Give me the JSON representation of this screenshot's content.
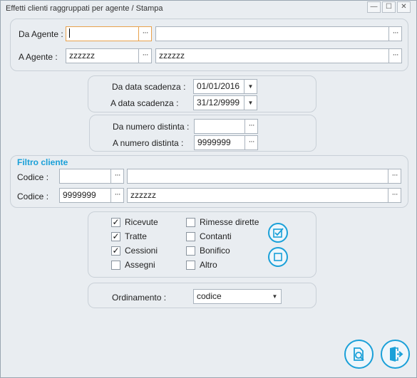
{
  "window": {
    "title": "Effetti clienti raggruppati per agente / Stampa"
  },
  "agent": {
    "from_label": "Da Agente :",
    "from_code": "",
    "from_desc": "",
    "to_label": "A Agente :",
    "to_code": "zzzzzz",
    "to_desc": "zzzzzz"
  },
  "dates": {
    "from_label": "Da data scadenza :",
    "from_value": "01/01/2016",
    "to_label": "A data scadenza :",
    "to_value": "31/12/9999"
  },
  "distinta": {
    "from_label": "Da numero distinta :",
    "from_value": "",
    "to_label": "A numero distinta :",
    "to_value": "9999999"
  },
  "client_filter": {
    "title": "Filtro cliente",
    "from_label": "Codice :",
    "from_code": "",
    "from_desc": "",
    "to_label": "Codice :",
    "to_code": "9999999",
    "to_desc": "zzzzzz"
  },
  "types": {
    "left": [
      {
        "label": "Ricevute",
        "checked": true
      },
      {
        "label": "Tratte",
        "checked": true
      },
      {
        "label": "Cessioni",
        "checked": true
      },
      {
        "label": "Assegni",
        "checked": false
      }
    ],
    "right": [
      {
        "label": "Rimesse dirette",
        "checked": false
      },
      {
        "label": "Contanti",
        "checked": false
      },
      {
        "label": "Bonifico",
        "checked": false
      },
      {
        "label": "Altro",
        "checked": false
      }
    ]
  },
  "ordering": {
    "label": "Ordinamento :",
    "value": "codice"
  },
  "icons": {
    "select_all": "check-all-icon",
    "deselect_all": "uncheck-all-icon",
    "preview": "print-preview-icon",
    "exit": "exit-icon",
    "accent": "#1aa0d8"
  }
}
